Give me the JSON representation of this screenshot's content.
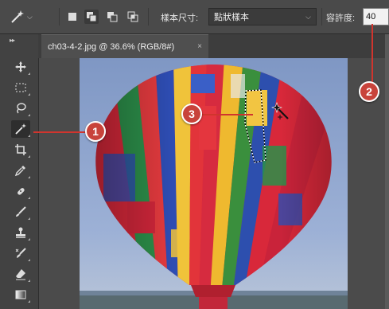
{
  "options_bar": {
    "sample_size_label": "樣本尺寸:",
    "sample_size_value": "點狀樣本",
    "tolerance_label": "容許度:",
    "tolerance_value": "40"
  },
  "document": {
    "tab_title": "ch03-4-2.jpg @ 36.6% (RGB/8#)",
    "close_glyph": "×"
  },
  "tools": [
    "move-tool",
    "marquee-tool",
    "lasso-tool",
    "magic-wand-tool",
    "crop-tool",
    "eyedropper-tool",
    "spot-healing-tool",
    "brush-tool",
    "clone-stamp-tool",
    "history-brush-tool",
    "eraser-tool",
    "gradient-tool"
  ],
  "callouts": {
    "one": "1",
    "two": "2",
    "three": "3"
  },
  "colors": {
    "accent": "#c8433b",
    "ui_dark": "#424242",
    "sky": "#8da6cf"
  }
}
